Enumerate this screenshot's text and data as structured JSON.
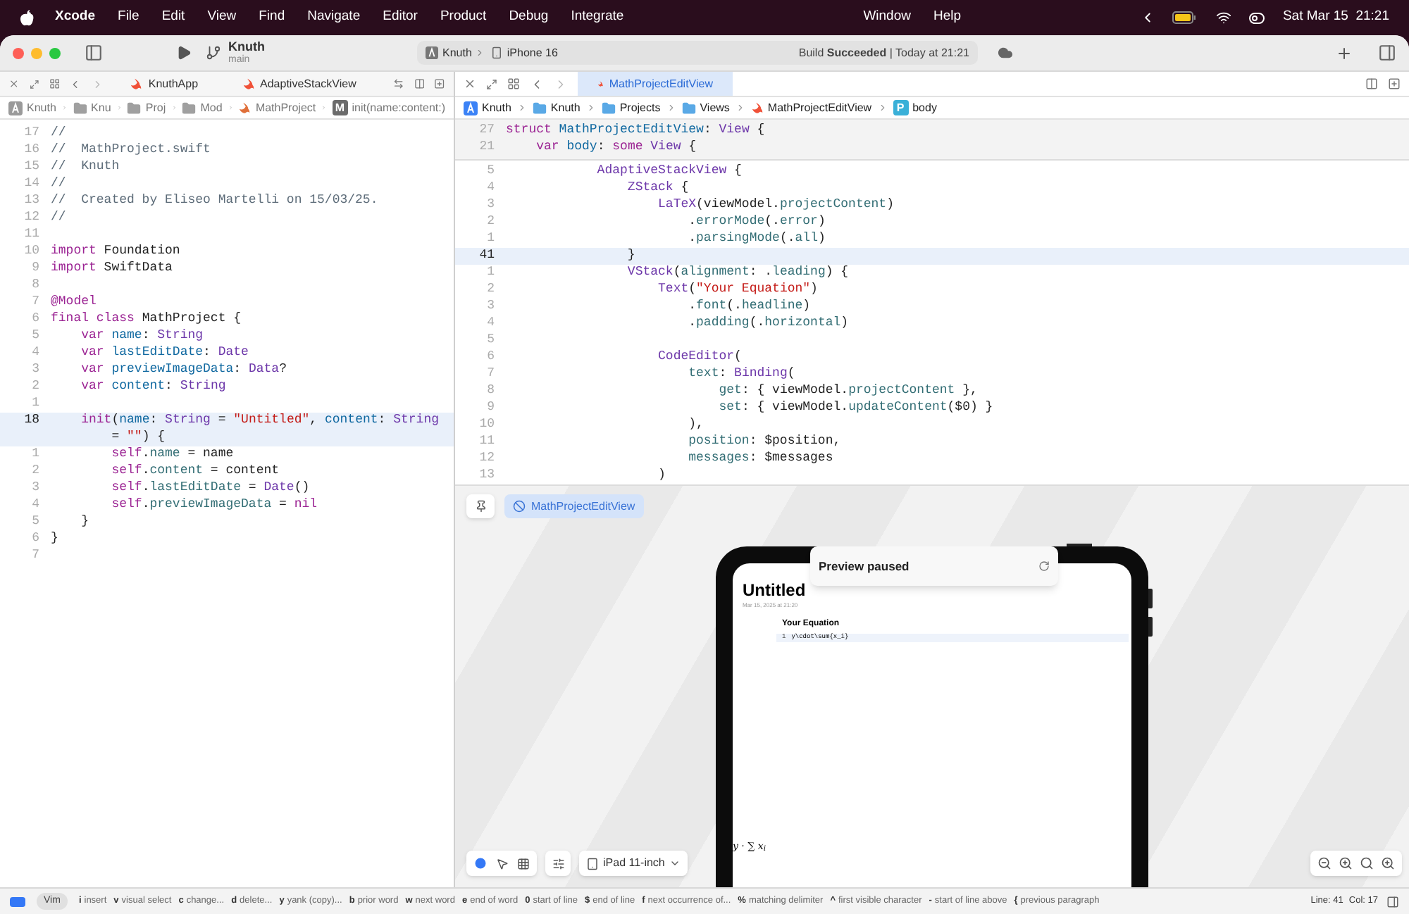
{
  "menu_bar": {
    "app_name": "Xcode",
    "menus": [
      "File",
      "Edit",
      "View",
      "Find",
      "Navigate",
      "Editor",
      "Product",
      "Debug",
      "Integrate"
    ],
    "menus_after_notch": [
      "Window",
      "Help"
    ],
    "clock": "Sat Mar 15  21:21"
  },
  "toolbar": {
    "scheme": "Knuth",
    "branch": "main",
    "destination": [
      "Knuth",
      "iPhone 16"
    ],
    "status": "Build **Succeeded** | Today at 21:21"
  },
  "left_editor": {
    "focused": false,
    "tabs": [
      {
        "label": "KnuthApp",
        "selected": false
      },
      {
        "label": "AdaptiveStackView",
        "selected": false
      }
    ],
    "breadcrumbs": [
      {
        "label": "Knuth",
        "kind": "app"
      },
      {
        "label": "Knu",
        "kind": "folder"
      },
      {
        "label": "Proj",
        "kind": "folder"
      },
      {
        "label": "Mod",
        "kind": "folder"
      },
      {
        "label": "MathProject",
        "kind": "swift"
      },
      {
        "label": "init(name:content:)",
        "kind": "symbol",
        "badge": "M"
      }
    ],
    "lines": [
      {
        "number": "17",
        "current": false,
        "segments": [
          {
            "kind": "comment",
            "text": "//"
          }
        ]
      },
      {
        "number": "16",
        "current": false,
        "segments": [
          {
            "kind": "comment",
            "text": "//  MathProject.swift"
          }
        ]
      },
      {
        "number": "15",
        "current": false,
        "segments": [
          {
            "kind": "comment",
            "text": "//  Knuth"
          }
        ]
      },
      {
        "number": "14",
        "current": false,
        "segments": [
          {
            "kind": "comment",
            "text": "//"
          }
        ]
      },
      {
        "number": "13",
        "current": false,
        "segments": [
          {
            "kind": "comment",
            "text": "//  Created by Eliseo Martelli on 15/03/25."
          }
        ]
      },
      {
        "number": "12",
        "current": false,
        "segments": [
          {
            "kind": "comment",
            "text": "//"
          }
        ]
      },
      {
        "number": "11",
        "current": false
      },
      {
        "number": "10",
        "current": false,
        "segments": [
          {
            "kind": "keyword",
            "text": "import"
          },
          {
            "kind": "plain",
            "text": " Foundation"
          }
        ]
      },
      {
        "number": "9",
        "current": false,
        "segments": [
          {
            "kind": "keyword",
            "text": "import"
          },
          {
            "kind": "plain",
            "text": " SwiftData"
          }
        ]
      },
      {
        "number": "8",
        "current": false
      },
      {
        "number": "7",
        "current": false,
        "segments": [
          {
            "kind": "keyword",
            "text": "@Model"
          }
        ]
      },
      {
        "number": "6",
        "current": false,
        "segments": [
          {
            "kind": "keyword",
            "text": "final class"
          },
          {
            "kind": "plain",
            "text": " MathProject {"
          }
        ]
      },
      {
        "number": "5",
        "current": false,
        "segments": [
          {
            "kind": "keyword",
            "text": "    var"
          },
          {
            "kind": "declaration",
            "text": " name"
          },
          {
            "kind": "plain",
            "text": ": "
          },
          {
            "kind": "type",
            "text": "String"
          }
        ]
      },
      {
        "number": "4",
        "current": false,
        "segments": [
          {
            "kind": "keyword",
            "text": "    var"
          },
          {
            "kind": "declaration",
            "text": " lastEditDate"
          },
          {
            "kind": "plain",
            "text": ": "
          },
          {
            "kind": "type",
            "text": "Date"
          }
        ]
      },
      {
        "number": "3",
        "current": false,
        "segments": [
          {
            "kind": "keyword",
            "text": "    var"
          },
          {
            "kind": "declaration",
            "text": " previewImageData"
          },
          {
            "kind": "plain",
            "text": ": "
          },
          {
            "kind": "type",
            "text": "Data"
          },
          {
            "kind": "plain",
            "text": "?"
          }
        ]
      },
      {
        "number": "2",
        "current": false,
        "segments": [
          {
            "kind": "keyword",
            "text": "    var"
          },
          {
            "kind": "declaration",
            "text": " content"
          },
          {
            "kind": "plain",
            "text": ": "
          },
          {
            "kind": "type",
            "text": "String"
          }
        ]
      },
      {
        "number": "1",
        "current": false
      },
      {
        "number": "18",
        "current": true,
        "segments": [
          {
            "kind": "keyword",
            "text": "    init"
          },
          {
            "kind": "plain",
            "text": "("
          },
          {
            "kind": "declaration",
            "text": "name"
          },
          {
            "kind": "plain",
            "text": ": "
          },
          {
            "kind": "type",
            "text": "String"
          },
          {
            "kind": "plain",
            "text": " = "
          },
          {
            "kind": "string",
            "text": "\"Untitled\""
          },
          {
            "kind": "plain",
            "text": ", "
          },
          {
            "kind": "declaration",
            "text": "content"
          },
          {
            "kind": "plain",
            "text": ": "
          },
          {
            "kind": "type",
            "text": "String"
          }
        ]
      },
      {
        "current": true,
        "segments": [
          {
            "kind": "plain",
            "text": "        = "
          },
          {
            "kind": "string",
            "text": "\"\""
          },
          {
            "kind": "plain",
            "text": ") {"
          }
        ]
      },
      {
        "number": "1",
        "current": false,
        "segments": [
          {
            "kind": "keyword",
            "text": "        self"
          },
          {
            "kind": "plain",
            "text": "."
          },
          {
            "kind": "member",
            "text": "name"
          },
          {
            "kind": "plain",
            "text": " = name"
          }
        ]
      },
      {
        "number": "2",
        "current": false,
        "segments": [
          {
            "kind": "keyword",
            "text": "        self"
          },
          {
            "kind": "plain",
            "text": "."
          },
          {
            "kind": "member",
            "text": "content"
          },
          {
            "kind": "plain",
            "text": " = content"
          }
        ]
      },
      {
        "number": "3",
        "current": false,
        "segments": [
          {
            "kind": "keyword",
            "text": "        self"
          },
          {
            "kind": "plain",
            "text": "."
          },
          {
            "kind": "member",
            "text": "lastEditDate"
          },
          {
            "kind": "plain",
            "text": " = "
          },
          {
            "kind": "type",
            "text": "Date"
          },
          {
            "kind": "plain",
            "text": "()"
          }
        ]
      },
      {
        "number": "4",
        "current": false,
        "segments": [
          {
            "kind": "keyword",
            "text": "        self"
          },
          {
            "kind": "plain",
            "text": "."
          },
          {
            "kind": "member",
            "text": "previewImageData"
          },
          {
            "kind": "plain",
            "text": " = "
          },
          {
            "kind": "keyword",
            "text": "nil"
          }
        ]
      },
      {
        "number": "5",
        "current": false,
        "segments": [
          {
            "kind": "plain",
            "text": "    }"
          }
        ]
      },
      {
        "number": "6",
        "current": false,
        "segments": [
          {
            "kind": "plain",
            "text": "}"
          }
        ]
      },
      {
        "number": "7",
        "current": false
      }
    ]
  },
  "right_editor": {
    "focused": true,
    "tabs": [
      {
        "label": "MathProjectEditView",
        "selected": true
      }
    ],
    "breadcrumbs": [
      {
        "label": "Knuth",
        "kind": "app"
      },
      {
        "label": "Knuth",
        "kind": "folder"
      },
      {
        "label": "Projects",
        "kind": "folder"
      },
      {
        "label": "Views",
        "kind": "folder"
      },
      {
        "label": "MathProjectEditView",
        "kind": "swift"
      },
      {
        "label": "body",
        "kind": "symbol",
        "badge": "P"
      }
    ],
    "sticky_lines": [
      {
        "number": "27",
        "segments": [
          {
            "kind": "keyword",
            "text": "struct"
          },
          {
            "kind": "declaration",
            "text": " MathProjectEditView"
          },
          {
            "kind": "plain",
            "text": ": "
          },
          {
            "kind": "type",
            "text": "View"
          },
          {
            "kind": "plain",
            "text": " {"
          }
        ]
      },
      {
        "number": "21",
        "segments": [
          {
            "kind": "keyword",
            "text": "    var"
          },
          {
            "kind": "declaration",
            "text": " body"
          },
          {
            "kind": "plain",
            "text": ": "
          },
          {
            "kind": "keyword",
            "text": "some"
          },
          {
            "kind": "type",
            "text": " View"
          },
          {
            "kind": "plain",
            "text": " {"
          }
        ]
      }
    ],
    "lines": [
      {
        "number": "5",
        "current": false,
        "segments": [
          {
            "kind": "type",
            "text": "            AdaptiveStackView"
          },
          {
            "kind": "plain",
            "text": " {"
          }
        ]
      },
      {
        "number": "4",
        "current": false,
        "segments": [
          {
            "kind": "type",
            "text": "                ZStack"
          },
          {
            "kind": "plain",
            "text": " {"
          }
        ]
      },
      {
        "number": "3",
        "current": false,
        "segments": [
          {
            "kind": "type",
            "text": "                    LaTeX"
          },
          {
            "kind": "plain",
            "text": "(viewModel."
          },
          {
            "kind": "member",
            "text": "projectContent"
          },
          {
            "kind": "plain",
            "text": ")"
          }
        ]
      },
      {
        "number": "2",
        "current": false,
        "segments": [
          {
            "kind": "plain",
            "text": "                        ."
          },
          {
            "kind": "member",
            "text": "errorMode"
          },
          {
            "kind": "plain",
            "text": "(."
          },
          {
            "kind": "member",
            "text": "error"
          },
          {
            "kind": "plain",
            "text": ")"
          }
        ]
      },
      {
        "number": "1",
        "current": false,
        "segments": [
          {
            "kind": "plain",
            "text": "                        ."
          },
          {
            "kind": "member",
            "text": "parsingMode"
          },
          {
            "kind": "plain",
            "text": "(."
          },
          {
            "kind": "member",
            "text": "all"
          },
          {
            "kind": "plain",
            "text": ")"
          }
        ]
      },
      {
        "number": "41",
        "current": true,
        "segments": [
          {
            "kind": "plain",
            "text": "                }"
          }
        ]
      },
      {
        "number": "1",
        "current": false,
        "segments": [
          {
            "kind": "type",
            "text": "                VStack"
          },
          {
            "kind": "plain",
            "text": "("
          },
          {
            "kind": "member",
            "text": "alignment"
          },
          {
            "kind": "plain",
            "text": ": ."
          },
          {
            "kind": "member",
            "text": "leading"
          },
          {
            "kind": "plain",
            "text": ") {"
          }
        ]
      },
      {
        "number": "2",
        "current": false,
        "segments": [
          {
            "kind": "type",
            "text": "                    Text"
          },
          {
            "kind": "plain",
            "text": "("
          },
          {
            "kind": "string",
            "text": "\"Your Equation\""
          },
          {
            "kind": "plain",
            "text": ")"
          }
        ]
      },
      {
        "number": "3",
        "current": false,
        "segments": [
          {
            "kind": "plain",
            "text": "                        ."
          },
          {
            "kind": "member",
            "text": "font"
          },
          {
            "kind": "plain",
            "text": "(."
          },
          {
            "kind": "member",
            "text": "headline"
          },
          {
            "kind": "plain",
            "text": ")"
          }
        ]
      },
      {
        "number": "4",
        "current": false,
        "segments": [
          {
            "kind": "plain",
            "text": "                        ."
          },
          {
            "kind": "member",
            "text": "padding"
          },
          {
            "kind": "plain",
            "text": "(."
          },
          {
            "kind": "member",
            "text": "horizontal"
          },
          {
            "kind": "plain",
            "text": ")"
          }
        ]
      },
      {
        "number": "5",
        "current": false
      },
      {
        "number": "6",
        "current": false,
        "segments": [
          {
            "kind": "type",
            "text": "                    CodeEditor"
          },
          {
            "kind": "plain",
            "text": "("
          }
        ]
      },
      {
        "number": "7",
        "current": false,
        "segments": [
          {
            "kind": "member",
            "text": "                        text"
          },
          {
            "kind": "plain",
            "text": ": "
          },
          {
            "kind": "type",
            "text": "Binding"
          },
          {
            "kind": "plain",
            "text": "("
          }
        ]
      },
      {
        "number": "8",
        "current": false,
        "segments": [
          {
            "kind": "member",
            "text": "                            get"
          },
          {
            "kind": "plain",
            "text": ": { viewModel."
          },
          {
            "kind": "member",
            "text": "projectContent"
          },
          {
            "kind": "plain",
            "text": " },"
          }
        ]
      },
      {
        "number": "9",
        "current": false,
        "segments": [
          {
            "kind": "member",
            "text": "                            set"
          },
          {
            "kind": "plain",
            "text": ": { viewModel."
          },
          {
            "kind": "member",
            "text": "updateContent"
          },
          {
            "kind": "plain",
            "text": "($0) }"
          }
        ]
      },
      {
        "number": "10",
        "current": false,
        "segments": [
          {
            "kind": "plain",
            "text": "                        ),"
          }
        ]
      },
      {
        "number": "11",
        "current": false,
        "segments": [
          {
            "kind": "member",
            "text": "                        position"
          },
          {
            "kind": "plain",
            "text": ": $position,"
          }
        ]
      },
      {
        "number": "12",
        "current": false,
        "segments": [
          {
            "kind": "member",
            "text": "                        messages"
          },
          {
            "kind": "plain",
            "text": ": $messages"
          }
        ]
      },
      {
        "number": "13",
        "current": false,
        "segments": [
          {
            "kind": "plain",
            "text": "                    )"
          }
        ]
      }
    ]
  },
  "preview": {
    "view_name": "MathProjectEditView",
    "banner": "Preview paused",
    "screen": {
      "title": "Untitled",
      "date": "Mar 15, 2025 at 21:20",
      "section": "Your Equation",
      "editor_line_number": "1",
      "editor_text": "y\\cdot\\sum{x_i}",
      "rendered": "y · ∑ x$_{i}$"
    },
    "device": "iPad 11-inch"
  },
  "status_bar": {
    "mode": "Vim",
    "hints": [
      {
        "key": "i",
        "label": "insert"
      },
      {
        "key": "v",
        "label": "visual select"
      },
      {
        "key": "c",
        "label": "change..."
      },
      {
        "key": "d",
        "label": "delete..."
      },
      {
        "key": "y",
        "label": "yank (copy)..."
      },
      {
        "key": "b",
        "label": "prior word"
      },
      {
        "key": "w",
        "label": "next word"
      },
      {
        "key": "e",
        "label": "end of word"
      },
      {
        "key": "0",
        "label": "start of line"
      },
      {
        "key": "$",
        "label": "end of line"
      },
      {
        "key": "f",
        "label": "next occurrence of..."
      },
      {
        "key": "%",
        "label": "matching delimiter"
      },
      {
        "key": "^",
        "label": "first visible character"
      },
      {
        "key": "-",
        "label": "start of line above"
      },
      {
        "key": "{",
        "label": "previous paragraph"
      }
    ],
    "line": "Line: 41",
    "column": "Col: 17"
  }
}
